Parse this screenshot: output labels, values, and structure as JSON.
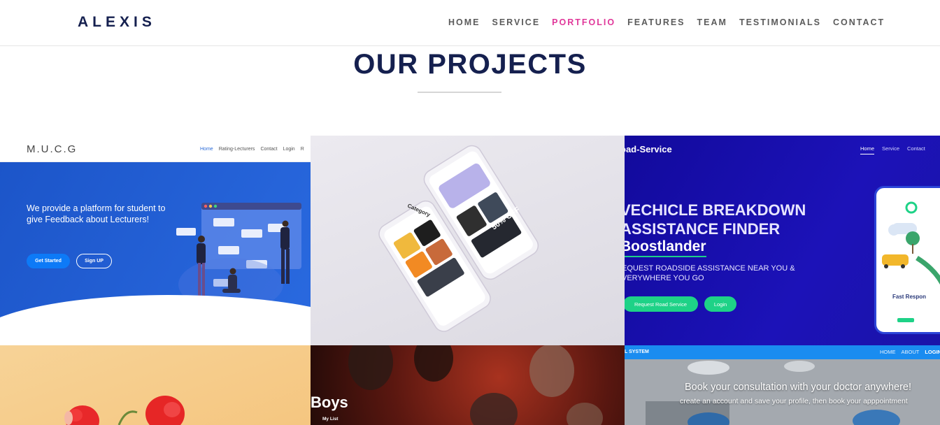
{
  "navbar": {
    "logo": "ALEXIS",
    "links": [
      "HOME",
      "SERVICE",
      "PORTFOLIO",
      "FEATURES",
      "TEAM",
      "TESTIMONIALS",
      "CONTACT"
    ],
    "active": "PORTFOLIO"
  },
  "section": {
    "title": "OUR PROJECTS"
  },
  "projects": {
    "mucg": {
      "brand": "M.U.C.G",
      "nav": [
        "Home",
        "Rating-Lecturers",
        "Contact",
        "Login",
        "R"
      ],
      "heading": "We provide a platform for student to give Feedback about Lecturers!",
      "primary_button": "Get Started",
      "secondary_button": "Sign UP"
    },
    "shop": {
      "category_label": "Category",
      "promo": "50% OFF"
    },
    "road": {
      "brand": "oad-Service",
      "nav": [
        "Home",
        "Service",
        "Contact"
      ],
      "heading_line1": "VECHICLE BREAKDOWN",
      "heading_line2": "ASSISTANCE FINDER",
      "highlight": "Boostlander",
      "sub_line1": "EQUEST ROADSIDE ASSISTANCE NEAR YOU &",
      "sub_line2": "VERYWHERE YOU GO",
      "primary_button": "Request Road Service",
      "secondary_button": "Login",
      "phone_label": "Fast Respon"
    },
    "boys": {
      "title": "Boys",
      "subtitle": "My List"
    },
    "doctor": {
      "brand": "L SYSTEM",
      "nav": [
        "HOME",
        "ABOUT",
        "LOGIN"
      ],
      "heading": "Book your consultation with your doctor anywhere!",
      "sub": "create an account and save your profile, then book your apppointment"
    }
  },
  "colors": {
    "navy": "#15204f",
    "pink": "#e0389a",
    "blue": "#1c55c9",
    "green": "#1ed287",
    "road_bg": "#120a9c"
  }
}
